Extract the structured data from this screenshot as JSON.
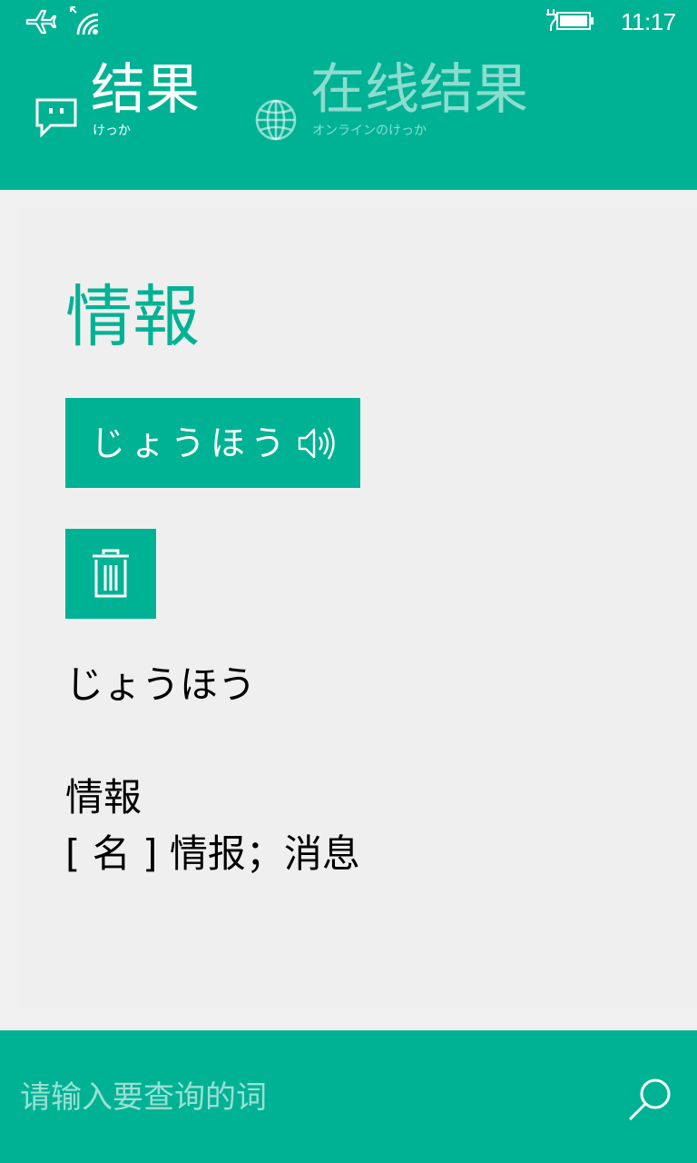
{
  "status_bar": {
    "time": "11:17",
    "icons": [
      "airplane-icon",
      "wifi-icon",
      "battery-charging-icon"
    ]
  },
  "tabs": [
    {
      "label": "结果",
      "sublabel": "けっか",
      "icon": "chat-icon",
      "active": true
    },
    {
      "label": "在线结果",
      "sublabel": "オンラインのけっか",
      "icon": "globe-icon",
      "active": false
    }
  ],
  "entry": {
    "headword": "情報",
    "reading_button_label": "じょうほう",
    "reading": "じょうほう",
    "word": "情報",
    "definition": "[ 名 ] 情报；消息"
  },
  "search": {
    "placeholder": "请输入要查询的词",
    "value": ""
  },
  "colors": {
    "accent": "#00B294",
    "content_background": "#F0F0F0",
    "text": "#000000"
  }
}
